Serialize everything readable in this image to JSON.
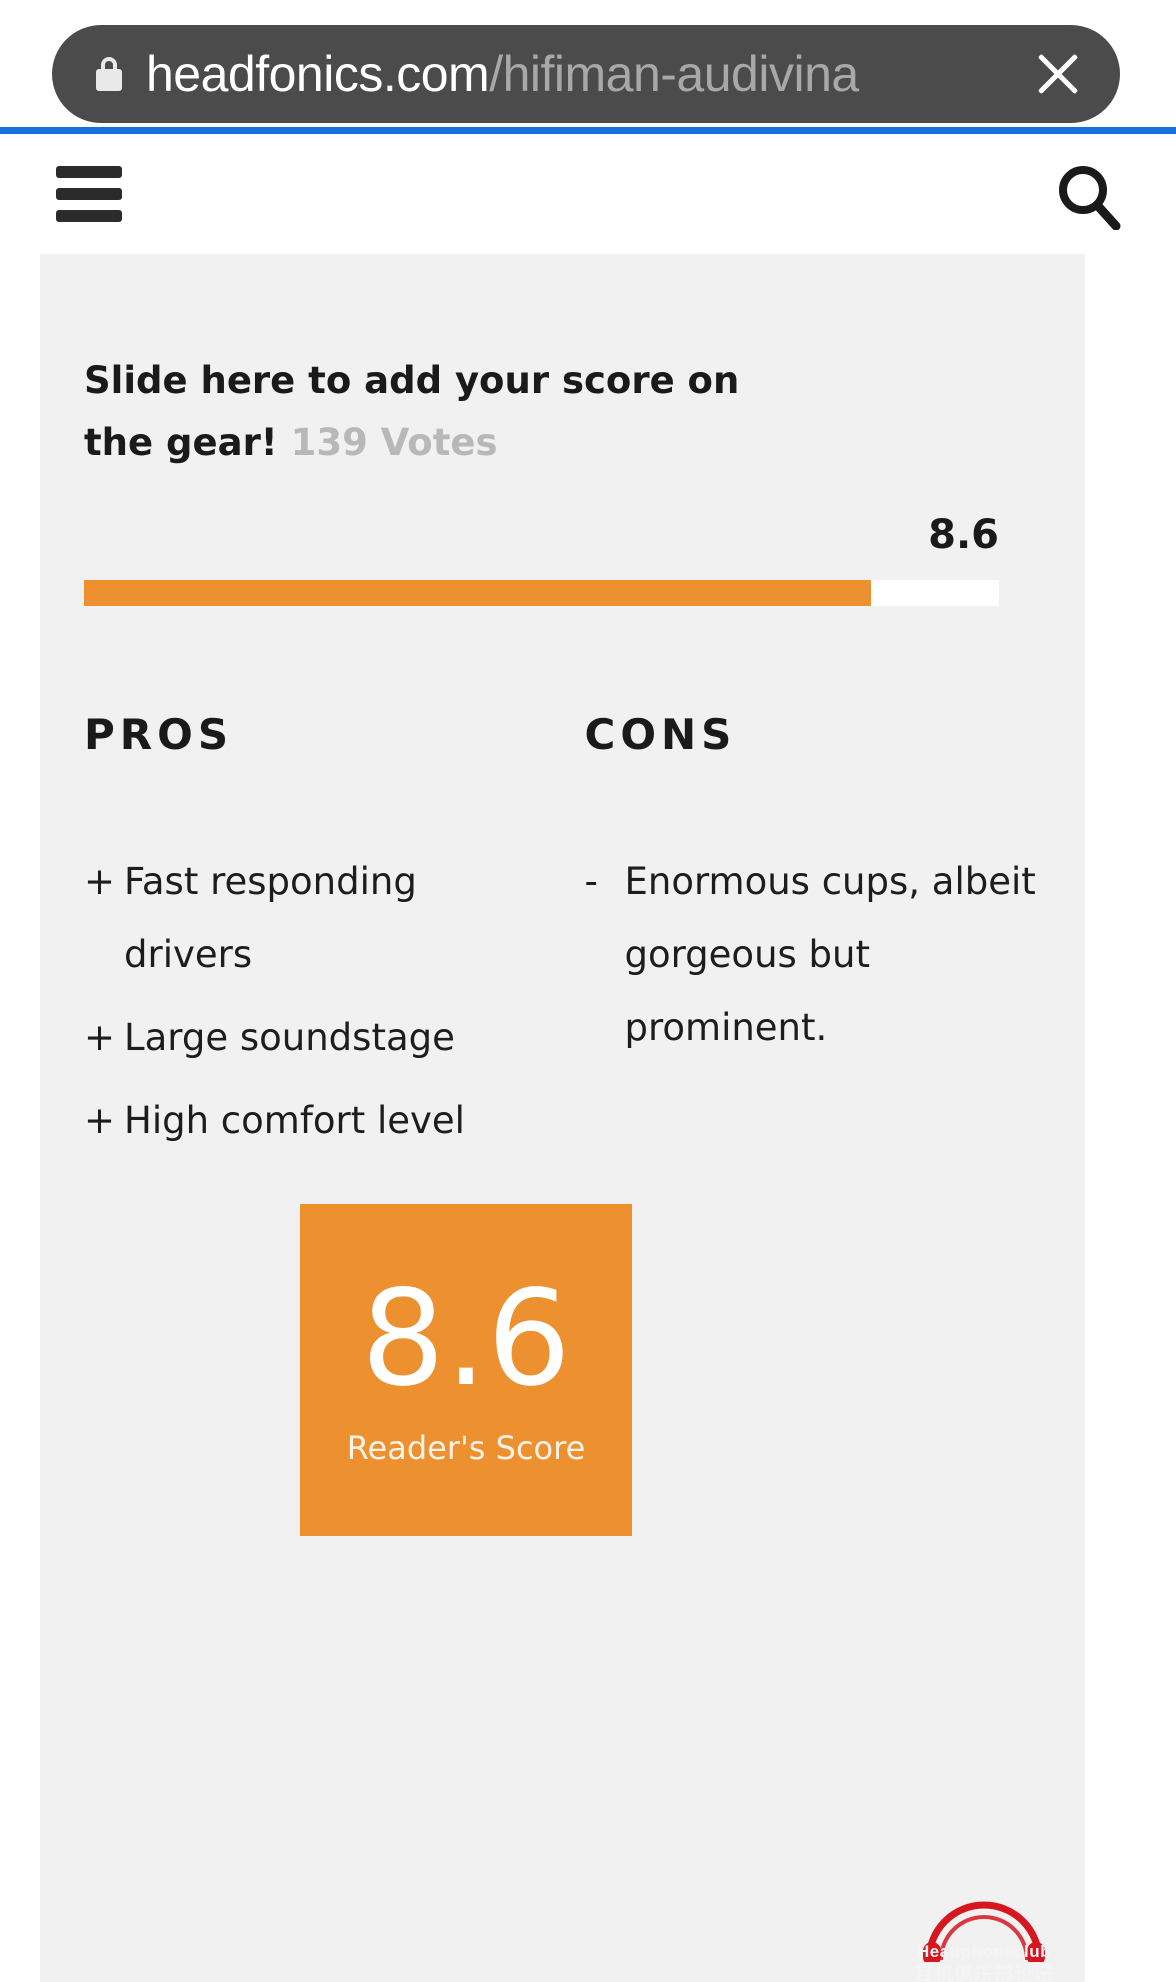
{
  "browser": {
    "lock_icon": "lock-icon",
    "url_host": "headfonics.com",
    "url_path": "/hifiman-audivina",
    "close_label": "close-icon",
    "progress_color": "#1a6fe0"
  },
  "site_header": {
    "menu_icon": "hamburger-menu-icon",
    "search_icon": "search-icon"
  },
  "review": {
    "slide_heading": "Slide here to add your score on the",
    "slide_heading_line2": "gear!",
    "votes": "139 Votes",
    "score_display": "8.6",
    "slider": {
      "value": 8.6,
      "max": 10,
      "fill_percent": 86,
      "fill_color": "#ec9030",
      "track_color": "#ffffff"
    },
    "pros": {
      "title": "PROS",
      "items": [
        {
          "sign": "+",
          "text": "Fast responding drivers"
        },
        {
          "sign": "+",
          "text": "Large soundstage"
        },
        {
          "sign": "+",
          "text": "High comfort level"
        }
      ]
    },
    "cons": {
      "title": "CONS",
      "items": [
        {
          "sign": "-",
          "text": "Enormous cups, albeit gorgeous but prominent."
        }
      ]
    },
    "reader_score": {
      "value": "8.6",
      "label": "Reader's Score",
      "box_color": "#ec9030"
    }
  },
  "watermark": {
    "brand": "Headphoneclub",
    "brand_cn": "耳机俱乐部论坛",
    "logo_color": "#d6171f"
  }
}
